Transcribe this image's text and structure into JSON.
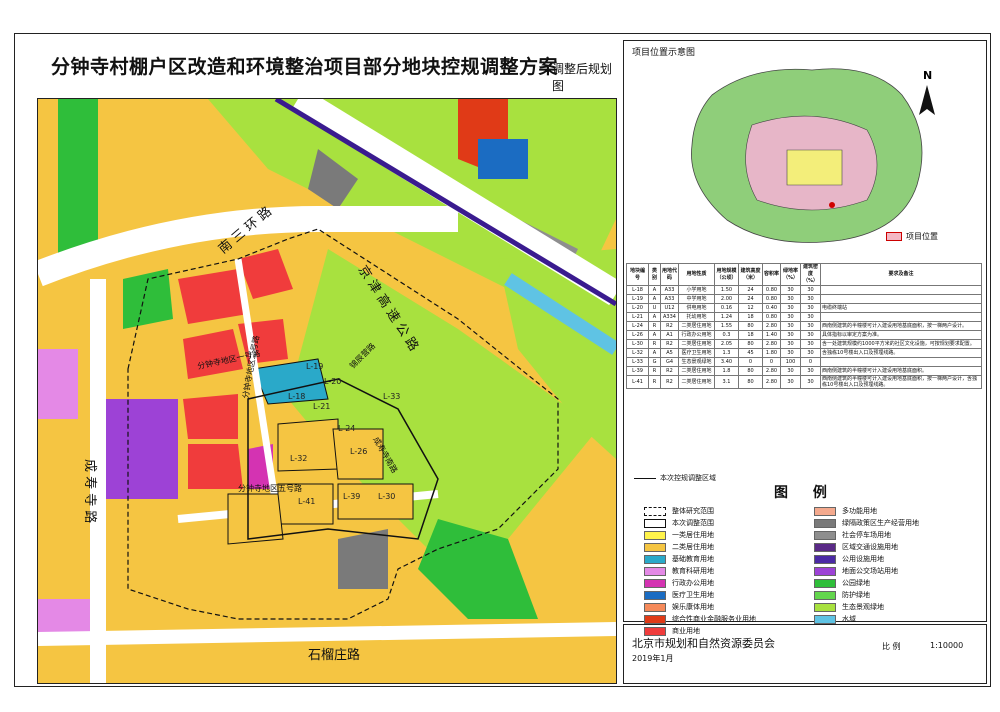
{
  "title": "分钟寺村棚户区改造和环境整治项目部分地块控规调整方案",
  "subtitle": "调整后规划图",
  "map": {
    "roads": {
      "south_third_ring": "南 三 环 路",
      "jingjin_expressway": "京 津 高 速 公 路",
      "chengshousi": "成 寿 寺 路",
      "shiliuzhuang": "石榴庄路",
      "fenzhongsi_north_1": "分钟寺地区一号路",
      "fenzhongsi_road": "分钟寺地区五号路",
      "xijiang_street": "锦辰营路",
      "tuanjie": "成寿寺南路",
      "fenzhongsi_road_2": "分钟寺地区二号路"
    },
    "parcels": [
      "L-18",
      "L-19",
      "L-20",
      "L-21",
      "L-24",
      "L-26",
      "L-30",
      "L-32",
      "L-33",
      "L-39",
      "L-41"
    ]
  },
  "location_panel": {
    "label": "项目位置示意图",
    "north": "N",
    "legend": "项目位置"
  },
  "control_table": {
    "headers": [
      "地块编号",
      "类别",
      "用地代码",
      "用地性质",
      "用地规模（公顷）",
      "建筑高度（米）",
      "容积率",
      "绿地率（%）",
      "建筑密度（%）",
      "要求及备注"
    ],
    "rows": [
      [
        "L-18",
        "A",
        "A33",
        "小学用地",
        "1.50",
        "24",
        "0.80",
        "30",
        "30",
        ""
      ],
      [
        "L-19",
        "A",
        "A33",
        "中学用地",
        "2.00",
        "24",
        "0.80",
        "30",
        "30",
        ""
      ],
      [
        "L-20",
        "U",
        "U12",
        "供电用地",
        "0.16",
        "12",
        "0.40",
        "30",
        "30",
        "电缆终端站"
      ],
      [
        "L-21",
        "A",
        "A334",
        "托幼用地",
        "1.24",
        "18",
        "0.80",
        "30",
        "30",
        ""
      ],
      [
        "L-24",
        "R",
        "R2",
        "二类居住用地",
        "1.55",
        "80",
        "2.80",
        "30",
        "30",
        "西南侧建筑的半幢楼可计入建设用地基底面积，按一梯两户设计。"
      ],
      [
        "L-26",
        "A",
        "A1",
        "行政办公用地",
        "0.3",
        "18",
        "1.40",
        "30",
        "30",
        "具体指标以审定方案为准。"
      ],
      [
        "L-30",
        "R",
        "R2",
        "二类居住用地",
        "2.05",
        "80",
        "2.80",
        "30",
        "30",
        "含一处建筑规模约1000平方米的社区文化设施，可按规划要求配置。"
      ],
      [
        "L-32",
        "A",
        "A5",
        "医疗卫生用地",
        "1.3",
        "45",
        "1.80",
        "30",
        "30",
        "含独栋10号楼出入口及预埋线路。"
      ],
      [
        "L-33",
        "G",
        "G4",
        "生态景观绿地",
        "3.40",
        "0",
        "0",
        "100",
        "0",
        ""
      ],
      [
        "L-39",
        "R",
        "R2",
        "二类居住用地",
        "1.8",
        "80",
        "2.80",
        "30",
        "30",
        "西南侧建筑的半幢楼可计入建设用地基底面积。"
      ],
      [
        "L-41",
        "R",
        "R2",
        "二类居住用地",
        "3.1",
        "80",
        "2.80",
        "30",
        "30",
        "西南侧建筑的半幢楼可计入建设用地基底面积，按一梯两户设计，含独栋10号楼出入口及预埋线路。"
      ]
    ]
  },
  "boundary_key": "本次控规调整区域",
  "legend_title": "图 例",
  "legend": {
    "left": [
      {
        "label": "整体研究范围",
        "color": "#ffffff",
        "style": "dashed"
      },
      {
        "label": "本次调整范围",
        "color": "#ffffff",
        "style": "solid"
      },
      {
        "label": "一类居住用地",
        "color": "#fff34a"
      },
      {
        "label": "二类居住用地",
        "color": "#f5c542"
      },
      {
        "label": "基础教育用地",
        "color": "#2aa9c9"
      },
      {
        "label": "教育科研用地",
        "color": "#e489e6"
      },
      {
        "label": "行政办公用地",
        "color": "#d433b2"
      },
      {
        "label": "医疗卫生用地",
        "color": "#1b6cc2"
      },
      {
        "label": "娱乐康体用地",
        "color": "#f58a5a"
      },
      {
        "label": "综合性商业金融服务业用地",
        "color": "#e03a17"
      },
      {
        "label": "商业用地",
        "color": "#f03c3c"
      }
    ],
    "right": [
      {
        "label": "多功能用地",
        "color": "#f4a98d"
      },
      {
        "label": "绿隔政策区生产经营用地",
        "color": "#7a7a7a"
      },
      {
        "label": "社会停车场用地",
        "color": "#8e8e8e"
      },
      {
        "label": "区域交通设施用地",
        "color": "#5a2a87"
      },
      {
        "label": "公用设施用地",
        "color": "#4b2aa5"
      },
      {
        "label": "地面公交场站用地",
        "color": "#9d42d6"
      },
      {
        "label": "公园绿地",
        "color": "#2fbe3a"
      },
      {
        "label": "防护绿地",
        "color": "#63d64d"
      },
      {
        "label": "生态景观绿地",
        "color": "#a8e13f"
      },
      {
        "label": "水域",
        "color": "#5fc3e4"
      }
    ]
  },
  "footer": {
    "agency": "北京市规划和自然资源委员会",
    "date": "2019年1月",
    "scale_label": "比 例",
    "scale_value": "1:10000"
  }
}
